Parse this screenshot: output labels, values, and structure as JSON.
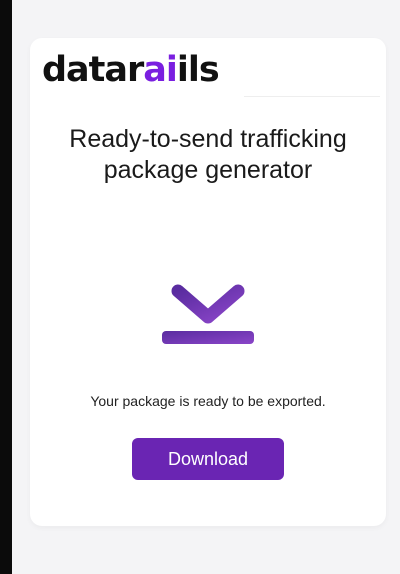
{
  "brand": {
    "logo_prefix": "datar",
    "logo_accent": "ai",
    "logo_suffix": "ils",
    "accent_color": "#7a1fe0"
  },
  "page": {
    "title": "Ready-to-send trafficking package generator"
  },
  "status": {
    "message": "Your package is ready to be exported."
  },
  "actions": {
    "download_label": "Download",
    "button_color": "#6a25b3"
  },
  "icons": {
    "main": "download-arrow-icon"
  }
}
